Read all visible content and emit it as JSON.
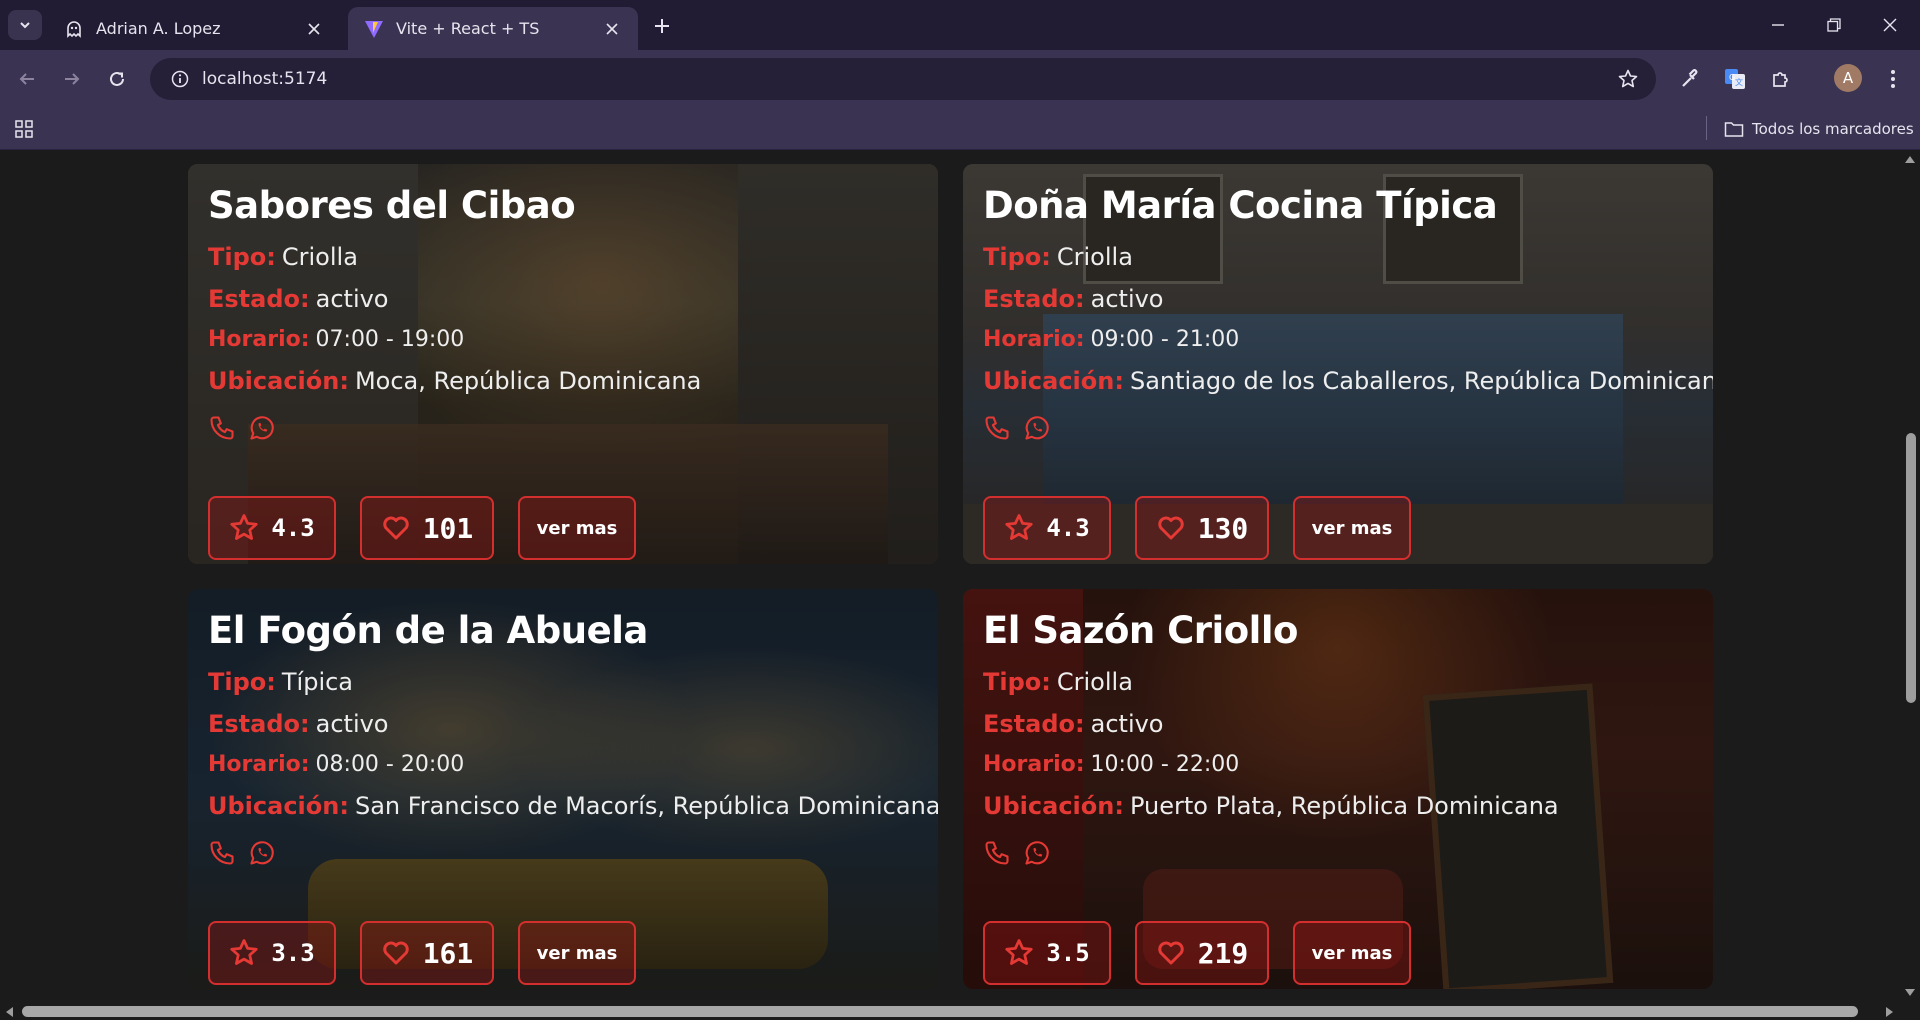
{
  "browser": {
    "tabs": [
      {
        "title": "Adrian A. Lopez",
        "icon": "ghost-icon",
        "active": false
      },
      {
        "title": "Vite + React + TS",
        "icon": "vite-logo-icon",
        "active": true
      }
    ],
    "url": "localhost:5174",
    "avatar_letter": "A",
    "bookmarks_all": "Todos los marcadores"
  },
  "colors": {
    "accent": "#e53935",
    "border": "#d32f2f",
    "chrome_bg": "#3b3352",
    "tabbar_bg": "#211c34"
  },
  "labels": {
    "tipo": "Tipo:",
    "estado": "Estado:",
    "horario": "Horario:",
    "ubicacion": "Ubicación:",
    "ver_mas": "ver mas"
  },
  "restaurants": [
    {
      "name": "Sabores del Cibao",
      "tipo": "Criolla",
      "estado": "activo",
      "horario": "07:00 - 19:00",
      "ubicacion": "Moca, República Dominicana",
      "rating": "4.3",
      "likes": "101"
    },
    {
      "name": "Doña María Cocina Típica",
      "tipo": "Criolla",
      "estado": "activo",
      "horario": "09:00 - 21:00",
      "ubicacion": "Santiago de los Caballeros, República Dominicana",
      "rating": "4.3",
      "likes": "130"
    },
    {
      "name": "El Fogón de la Abuela",
      "tipo": "Típica",
      "estado": "activo",
      "horario": "08:00 - 20:00",
      "ubicacion": "San Francisco de Macorís, República Dominicana",
      "rating": "3.3",
      "likes": "161"
    },
    {
      "name": "El Sazón Criollo",
      "tipo": "Criolla",
      "estado": "activo",
      "horario": "10:00 - 22:00",
      "ubicacion": "Puerto Plata, República Dominicana",
      "rating": "3.5",
      "likes": "219"
    }
  ]
}
